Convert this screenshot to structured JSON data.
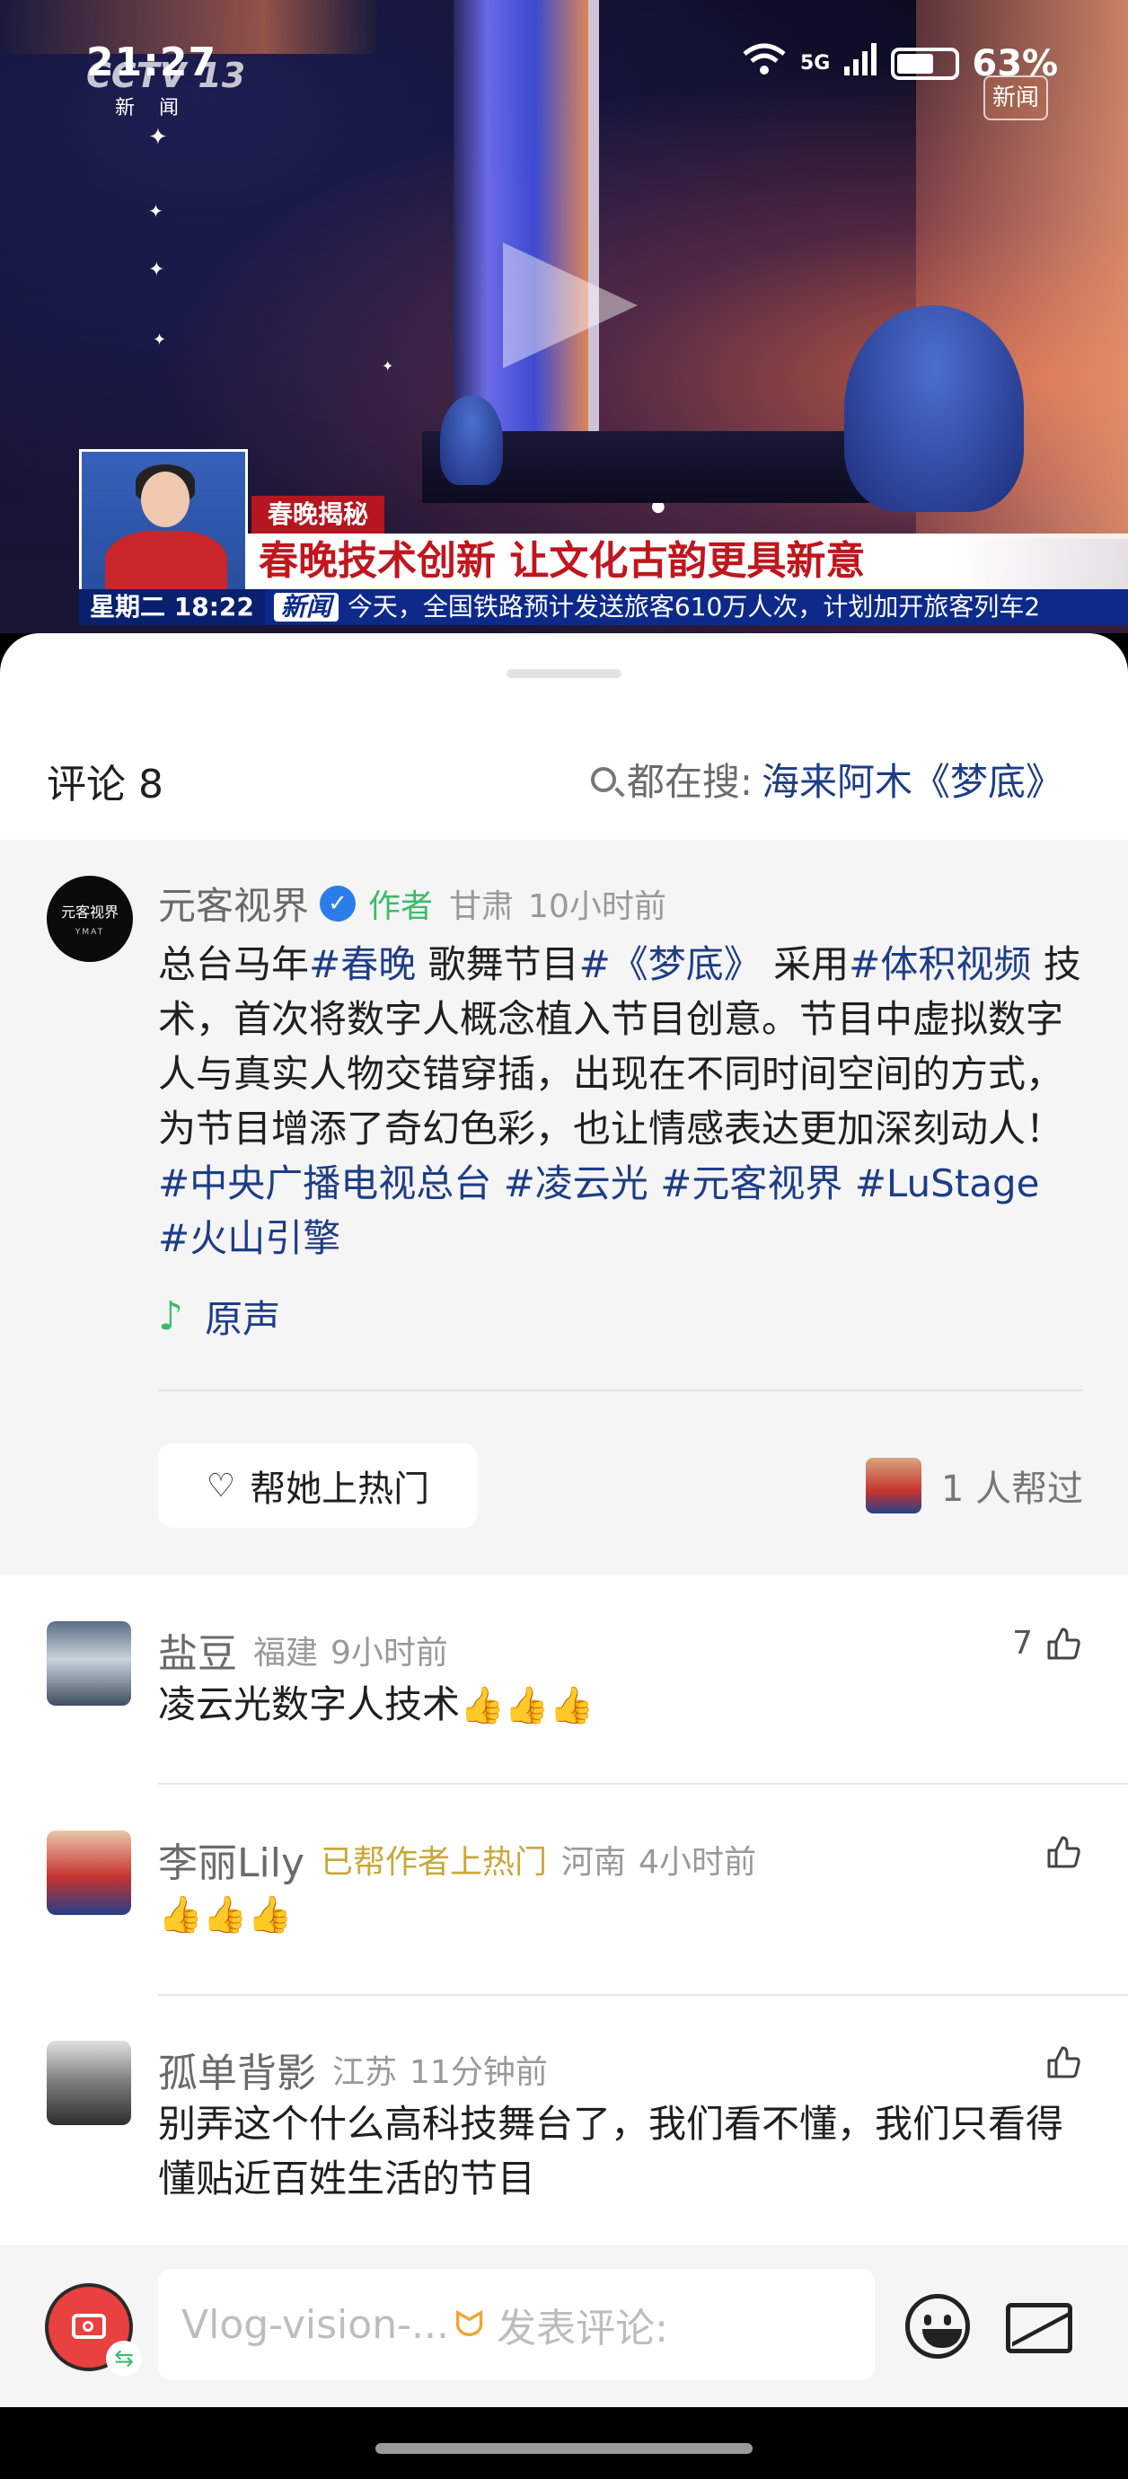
{
  "status_bar": {
    "time": "21:27",
    "network": "5G",
    "battery": "63%"
  },
  "video": {
    "channel_logo": "CCTV 13",
    "channel_sub": "新 闻",
    "corner_badge": "新闻",
    "segment_label": "春晚揭秘",
    "headline": "春晚技术创新 让文化古韵更具新意",
    "ticker_day": "星期二 18:22",
    "ticker_tag": "新闻",
    "ticker_text": "今天，全国铁路预计发送旅客610万人次，计划加开旅客列车2"
  },
  "header": {
    "comments_label": "评论 8",
    "search_prefix": "都在搜:",
    "search_keyword": "海来阿木《梦底》"
  },
  "post": {
    "avatar_text": "元客视界",
    "avatar_sub": "YMAT",
    "author": "元客视界",
    "author_tag": "作者",
    "location": "甘肃",
    "time": "10小时前",
    "text_1": "总台马年",
    "hashtag_1": "#春晚",
    "text_2": " 歌舞节目",
    "hashtag_2": "#《梦底》",
    "text_3": " 采用",
    "hashtag_3": "#体积视频",
    "text_4": " 技术，首次将数字人概念植入节目创意。节目中虚拟数字人与真实人物交错穿插，出现在不同时间空间的方式，为节目增添了奇幻色彩，也让情感表达更加深刻动人！",
    "hashtag_4": "#中央广播电视总台",
    "hashtag_5": "#凌云光",
    "hashtag_6": "#元客视界",
    "hashtag_7": "#LuStage",
    "hashtag_8": "#火山引擎",
    "music_label": "原声",
    "boost_button": "帮她上热门",
    "helped_text": "1 人帮过"
  },
  "comments": [
    {
      "name": "盐豆",
      "location": "福建",
      "time": "9小时前",
      "text": "凌云光数字人技术",
      "emoji": "👍👍👍",
      "likes": "7"
    },
    {
      "name": "李丽Lily",
      "badge": "已帮作者上热门",
      "location": "河南",
      "time": "4小时前",
      "text": "",
      "emoji": "👍👍👍",
      "likes": ""
    },
    {
      "name": "孤单背影",
      "location": "江苏",
      "time": "11分钟前",
      "text": "别弄这个什么高科技舞台了，我们看不懂，我们只看得懂贴近百姓生活的节目",
      "emoji": "",
      "likes": ""
    }
  ],
  "input": {
    "prefix": "Vlog-vision-...",
    "placeholder": "发表评论:"
  },
  "icons": {
    "play": "play-icon",
    "search": "search-icon",
    "verified": "verified-icon",
    "music": "music-note-icon",
    "heart": "heart-icon",
    "thumb": "thumb-up-icon",
    "camera": "camera-icon",
    "emoji": "emoji-icon",
    "image": "image-icon"
  },
  "colors": {
    "hashtag": "#1d3d86",
    "author_tag": "#3dba6c",
    "boost_badge": "#c9a73a",
    "headline_red": "#c0161d"
  }
}
